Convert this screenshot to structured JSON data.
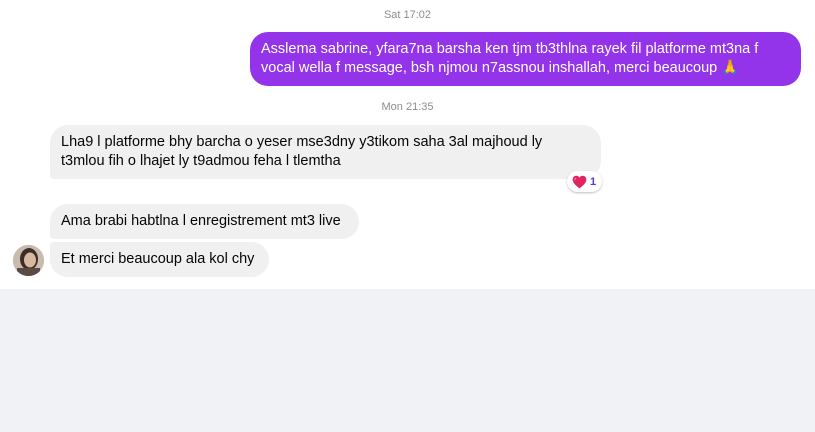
{
  "thread": {
    "timestamps": [
      "Sat 17:02",
      "Mon 21:35"
    ],
    "messages": [
      {
        "direction": "outgoing",
        "lines": [
          "Asslema sabrine, yfara7na barsha ken tjm tb3thlna rayek fil platforme mt3na f",
          "vocal wella f message, bsh njmou n7assnou inshallah, merci beaucoup 🙏"
        ]
      },
      {
        "direction": "incoming",
        "lines": [
          "Lha9 l platforme bhy barcha o yeser mse3dny y3tikom saha 3al majhoud ly",
          "t3mlou fih o lhajet ly t9admou feha l tlemtha"
        ],
        "reaction": {
          "emoji": "❤️",
          "count": "1"
        }
      },
      {
        "direction": "incoming",
        "lines": [
          "Ama brabi habtlna l enregistrement mt3 live"
        ]
      },
      {
        "direction": "incoming",
        "lines": [
          "Et merci beaucoup ala kol chy"
        ]
      }
    ]
  },
  "colors": {
    "outgoing_bubble": "#9333ea",
    "incoming_bubble": "#f0f0f0",
    "reaction_count": "#4b3fd6",
    "page_bg": "#f0f2f5"
  },
  "icons": {
    "reaction": "heart-icon",
    "avatar": "contact-avatar"
  }
}
